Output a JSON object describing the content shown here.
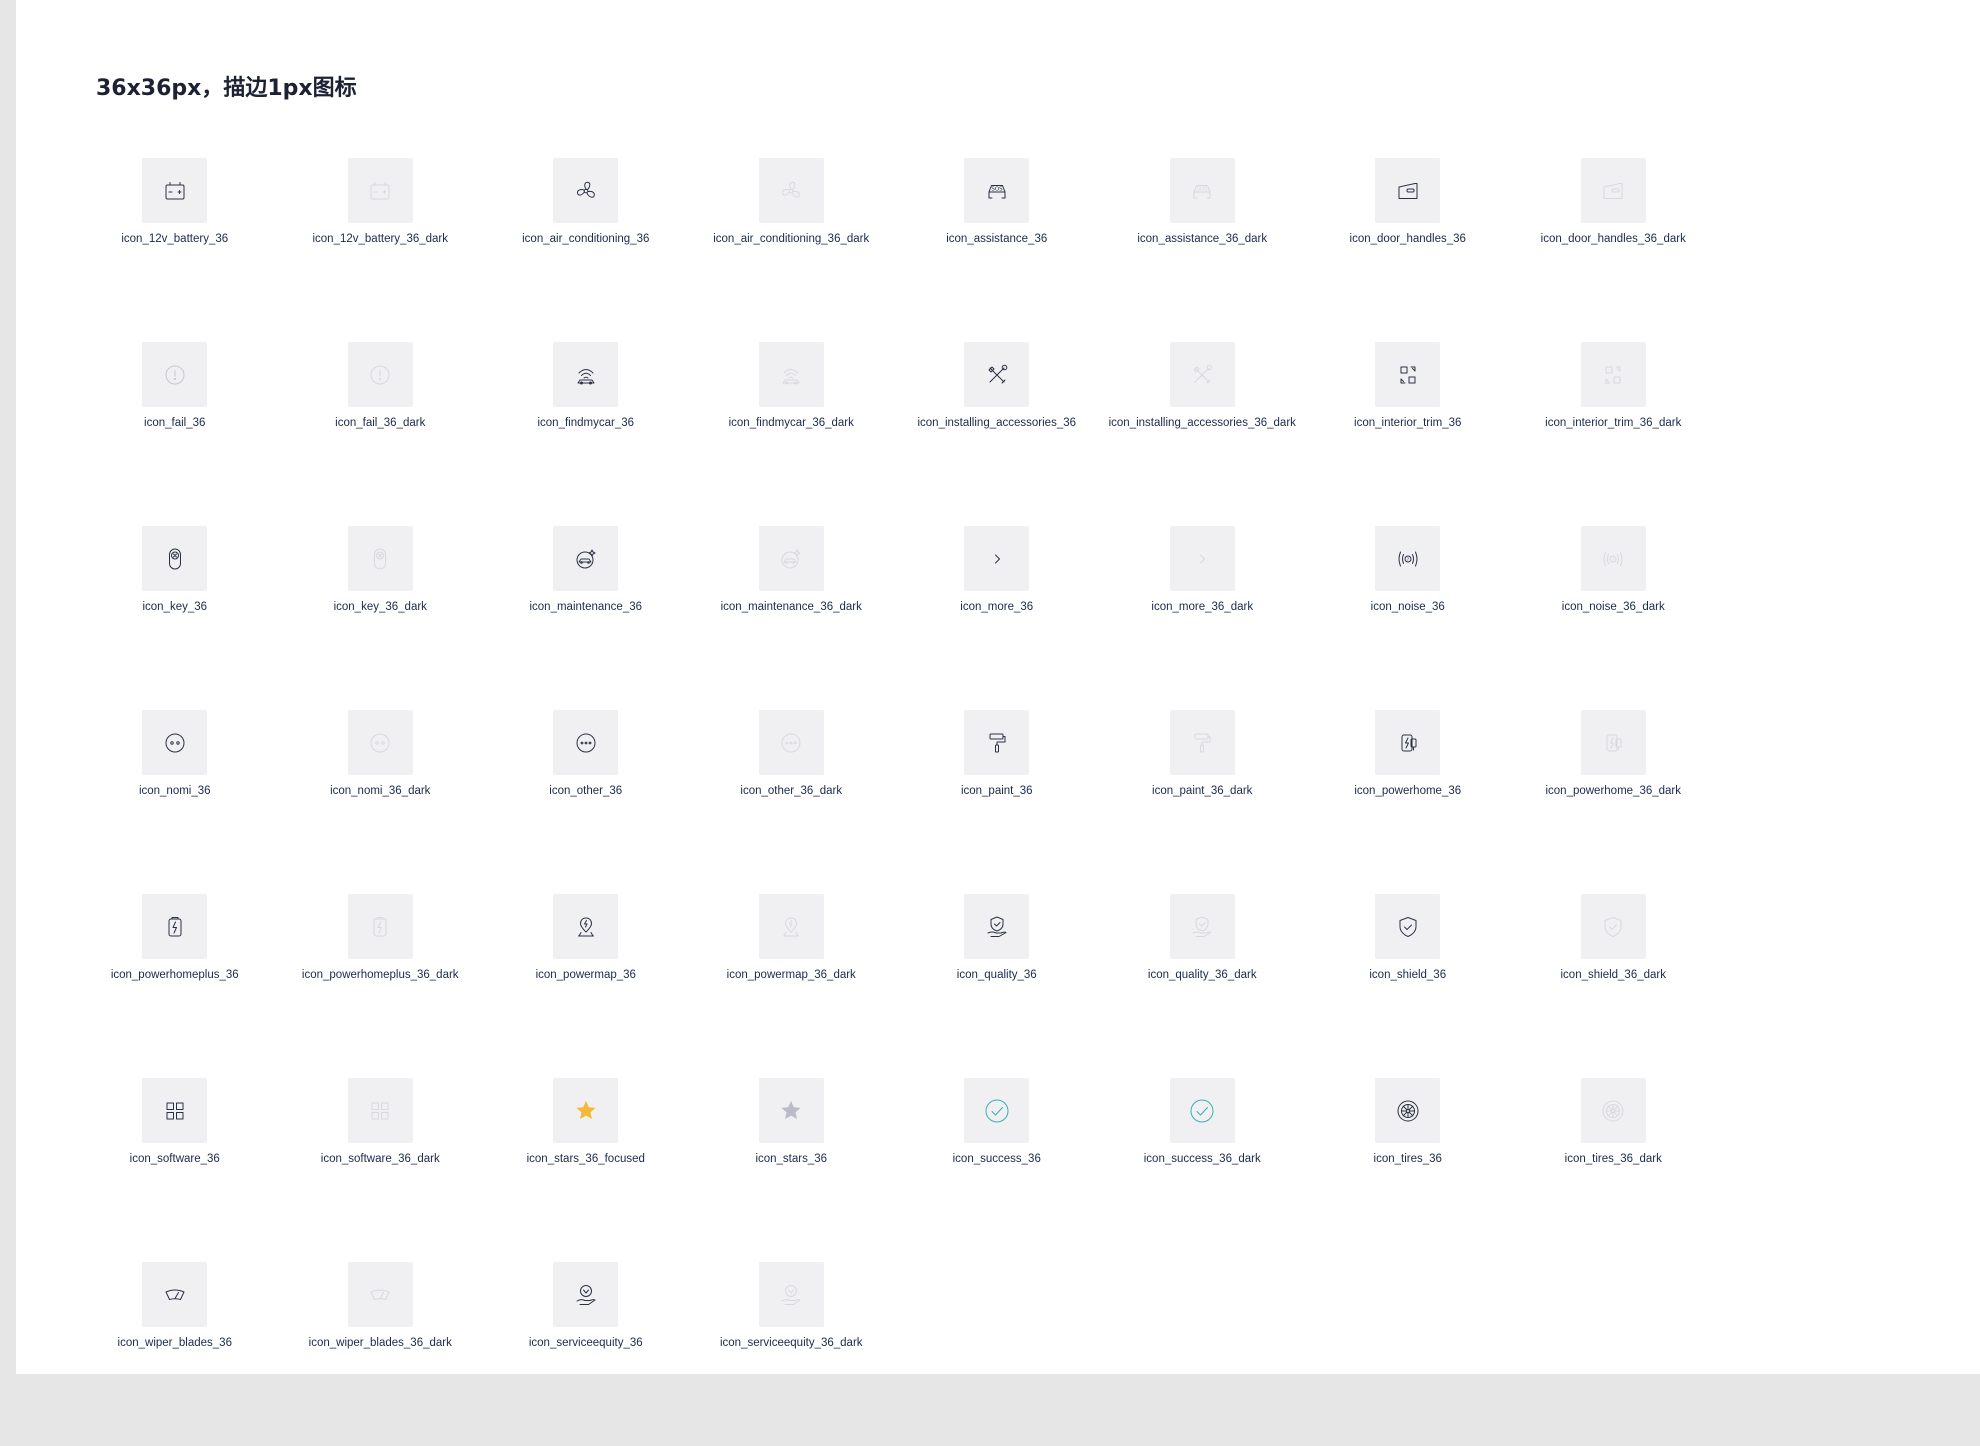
{
  "section_title": "36x36px，描边1px图标",
  "colors": {
    "stroke": "#2b3145",
    "stroke_dark": "#d8d9de",
    "star_focused": "#f5b93a",
    "star_plain": "#b9bcc6",
    "success": "#3ab0b0"
  },
  "icons": [
    {
      "label": "icon_12v_battery_36",
      "icon": "battery-icon",
      "variant": "normal"
    },
    {
      "label": "icon_12v_battery_36_dark",
      "icon": "battery-icon",
      "variant": "dark"
    },
    {
      "label": "icon_air_conditioning_36",
      "icon": "fan-icon",
      "variant": "normal"
    },
    {
      "label": "icon_air_conditioning_36_dark",
      "icon": "fan-icon",
      "variant": "dark"
    },
    {
      "label": "icon_assistance_36",
      "icon": "sos-car-icon",
      "variant": "normal"
    },
    {
      "label": "icon_assistance_36_dark",
      "icon": "sos-car-icon",
      "variant": "dark"
    },
    {
      "label": "icon_door_handles_36",
      "icon": "door-handle-icon",
      "variant": "normal"
    },
    {
      "label": "icon_door_handles_36_dark",
      "icon": "door-handle-icon",
      "variant": "dark"
    },
    {
      "label": "icon_fail_36",
      "icon": "fail-icon",
      "variant": "light"
    },
    {
      "label": "icon_fail_36_dark",
      "icon": "fail-icon",
      "variant": "dark"
    },
    {
      "label": "icon_findmycar_36",
      "icon": "find-car-icon",
      "variant": "normal"
    },
    {
      "label": "icon_findmycar_36_dark",
      "icon": "find-car-icon",
      "variant": "dark"
    },
    {
      "label": "icon_installing_accessories_36",
      "icon": "tools-icon",
      "variant": "normal"
    },
    {
      "label": "icon_installing_accessories_36_dark",
      "icon": "tools-icon",
      "variant": "dark"
    },
    {
      "label": "icon_interior_trim_36",
      "icon": "interior-trim-icon",
      "variant": "normal"
    },
    {
      "label": "icon_interior_trim_36_dark",
      "icon": "interior-trim-icon",
      "variant": "dark"
    },
    {
      "label": "icon_key_36",
      "icon": "key-icon",
      "variant": "normal"
    },
    {
      "label": "icon_key_36_dark",
      "icon": "key-icon",
      "variant": "dark"
    },
    {
      "label": "icon_maintenance_36",
      "icon": "maintenance-icon",
      "variant": "normal"
    },
    {
      "label": "icon_maintenance_36_dark",
      "icon": "maintenance-icon",
      "variant": "dark"
    },
    {
      "label": "icon_more_36",
      "icon": "chevron-right-icon",
      "variant": "normal"
    },
    {
      "label": "icon_more_36_dark",
      "icon": "chevron-right-icon",
      "variant": "dark"
    },
    {
      "label": "icon_noise_36",
      "icon": "noise-icon",
      "variant": "normal"
    },
    {
      "label": "icon_noise_36_dark",
      "icon": "noise-icon",
      "variant": "dark"
    },
    {
      "label": "icon_nomi_36",
      "icon": "nomi-icon",
      "variant": "normal"
    },
    {
      "label": "icon_nomi_36_dark",
      "icon": "nomi-icon",
      "variant": "dark"
    },
    {
      "label": "icon_other_36",
      "icon": "more-dots-icon",
      "variant": "normal"
    },
    {
      "label": "icon_other_36_dark",
      "icon": "more-dots-icon",
      "variant": "dark"
    },
    {
      "label": "icon_paint_36",
      "icon": "paint-roller-icon",
      "variant": "normal"
    },
    {
      "label": "icon_paint_36_dark",
      "icon": "paint-roller-icon",
      "variant": "dark"
    },
    {
      "label": "icon_powerhome_36",
      "icon": "power-home-icon",
      "variant": "normal"
    },
    {
      "label": "icon_powerhome_36_dark",
      "icon": "power-home-icon",
      "variant": "dark"
    },
    {
      "label": "icon_powerhomeplus_36",
      "icon": "power-home-plus-icon",
      "variant": "normal"
    },
    {
      "label": "icon_powerhomeplus_36_dark",
      "icon": "power-home-plus-icon",
      "variant": "dark"
    },
    {
      "label": "icon_powermap_36",
      "icon": "power-map-icon",
      "variant": "normal"
    },
    {
      "label": "icon_powermap_36_dark",
      "icon": "power-map-icon",
      "variant": "dark"
    },
    {
      "label": "icon_quality_36",
      "icon": "quality-icon",
      "variant": "normal"
    },
    {
      "label": "icon_quality_36_dark",
      "icon": "quality-icon",
      "variant": "dark"
    },
    {
      "label": "icon_shield_36",
      "icon": "shield-icon",
      "variant": "normal"
    },
    {
      "label": "icon_shield_36_dark",
      "icon": "shield-icon",
      "variant": "dark"
    },
    {
      "label": "icon_software_36",
      "icon": "software-grid-icon",
      "variant": "normal"
    },
    {
      "label": "icon_software_36_dark",
      "icon": "software-grid-icon",
      "variant": "dark"
    },
    {
      "label": "icon_stars_36_focused",
      "icon": "star-icon",
      "variant": "focused"
    },
    {
      "label": "icon_stars_36",
      "icon": "star-icon",
      "variant": "plain"
    },
    {
      "label": "icon_success_36",
      "icon": "success-icon",
      "variant": "success"
    },
    {
      "label": "icon_success_36_dark",
      "icon": "success-icon",
      "variant": "success"
    },
    {
      "label": "icon_tires_36",
      "icon": "tire-icon",
      "variant": "normal"
    },
    {
      "label": "icon_tires_36_dark",
      "icon": "tire-icon",
      "variant": "dark"
    },
    {
      "label": "icon_wiper_blades_36",
      "icon": "wiper-icon",
      "variant": "normal"
    },
    {
      "label": "icon_wiper_blades_36_dark",
      "icon": "wiper-icon",
      "variant": "dark"
    },
    {
      "label": "icon_serviceequity_36",
      "icon": "service-equity-icon",
      "variant": "normal"
    },
    {
      "label": "icon_serviceequity_36_dark",
      "icon": "service-equity-icon",
      "variant": "dark"
    }
  ]
}
